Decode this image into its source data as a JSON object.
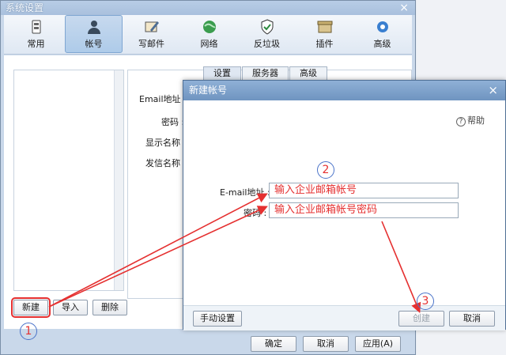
{
  "main_window": {
    "title": "系统设置",
    "close_glyph": "×",
    "toolbar": [
      {
        "label": "常用",
        "icon": "settings-icon"
      },
      {
        "label": "帐号",
        "icon": "user-icon"
      },
      {
        "label": "写邮件",
        "icon": "compose-icon"
      },
      {
        "label": "网络",
        "icon": "globe-icon"
      },
      {
        "label": "反垃圾",
        "icon": "shield-icon"
      },
      {
        "label": "插件",
        "icon": "box-icon"
      },
      {
        "label": "高级",
        "icon": "gear-icon"
      }
    ],
    "left_buttons": {
      "new": "新建",
      "import": "导入",
      "delete": "删除"
    },
    "tabs": [
      "设置",
      "服务器",
      "高级"
    ],
    "fields": [
      "Email地址 :",
      "密码 :",
      "显示名称 :",
      "发信名称 :"
    ],
    "footer": {
      "ok": "确定",
      "cancel": "取消",
      "apply": "应用(A)"
    }
  },
  "dialog": {
    "title": "新建帐号",
    "close_glyph": "×",
    "help": "帮助",
    "email_label": "E-mail地址 :",
    "email_placeholder": "输入企业邮箱帐号",
    "password_label": "密码 :",
    "password_placeholder": "输入企业邮箱帐号密码",
    "manual_button": "手动设置",
    "create_button": "创建",
    "cancel_button": "取消"
  },
  "annotations": [
    "1",
    "2",
    "3"
  ],
  "colors": {
    "annotation": "#e53030",
    "circle": "#4a73c9"
  }
}
